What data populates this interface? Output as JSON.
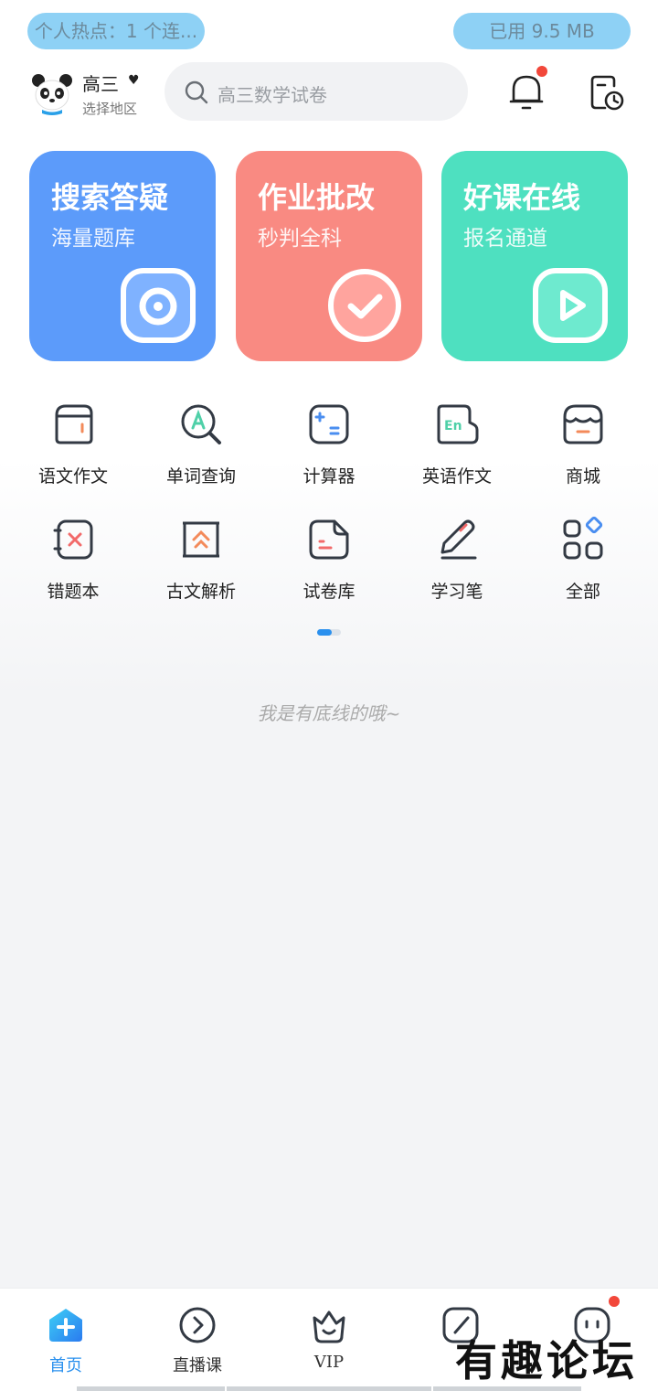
{
  "status": {
    "hot_topic": "个人热点：1 个连...",
    "data_used": "已用 9.5 MB"
  },
  "header": {
    "grade": "高三",
    "region": "选择地区",
    "search_placeholder": "高三数学试卷"
  },
  "cards": [
    {
      "title": "搜索答疑",
      "subtitle": "海量题库",
      "color": "#5c9bfa",
      "icon": "camera-icon"
    },
    {
      "title": "作业批改",
      "subtitle": "秒判全科",
      "color": "#f98a82",
      "icon": "check-icon"
    },
    {
      "title": "好课在线",
      "subtitle": "报名通道",
      "color": "#4ee0c0",
      "icon": "play-icon"
    }
  ],
  "tools": [
    {
      "label": "语文作文",
      "icon": "notebook-icon"
    },
    {
      "label": "单词查询",
      "icon": "word-search-icon"
    },
    {
      "label": "计算器",
      "icon": "calculator-icon"
    },
    {
      "label": "英语作文",
      "icon": "english-icon"
    },
    {
      "label": "商城",
      "icon": "store-icon"
    },
    {
      "label": "错题本",
      "icon": "wrong-book-icon"
    },
    {
      "label": "古文解析",
      "icon": "classical-icon"
    },
    {
      "label": "试卷库",
      "icon": "paper-icon"
    },
    {
      "label": "学习笔",
      "icon": "pen-icon"
    },
    {
      "label": "全部",
      "icon": "all-icon"
    }
  ],
  "footer_note": "我是有底线的哦~",
  "tabs": [
    {
      "label": "首页",
      "active": true,
      "icon": "home-plus-icon"
    },
    {
      "label": "直播课",
      "active": false,
      "icon": "live-icon"
    },
    {
      "label": "VIP",
      "active": false,
      "icon": "vip-crown-icon"
    },
    {
      "label": "",
      "active": false,
      "icon": "pencil-icon"
    },
    {
      "label": "",
      "active": false,
      "icon": "mine-face-icon"
    }
  ],
  "watermark": "有趣论坛",
  "colors": {
    "accent": "#2a90ee",
    "badge": "#f2473a",
    "icon_stroke": "#333a44",
    "icon_accent": "#f38a5a"
  }
}
